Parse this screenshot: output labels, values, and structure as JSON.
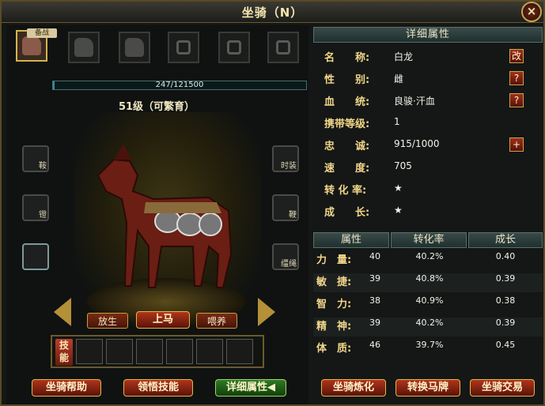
{
  "window": {
    "title": "坐骑（N）",
    "close_label": "×"
  },
  "mount_slots": [
    {
      "tag": "备战",
      "active": true
    },
    {
      "tag": "",
      "active": false
    },
    {
      "tag": "",
      "active": false
    },
    {
      "tag": "",
      "active": false
    },
    {
      "tag": "",
      "active": false
    },
    {
      "tag": "",
      "active": false
    }
  ],
  "exp": {
    "text": "247/121500",
    "current": 247,
    "max": 121500
  },
  "level_text": "51级（可繁育）",
  "equip_left": [
    {
      "label": "鞍"
    },
    {
      "label": "镫"
    },
    {
      "label": ""
    }
  ],
  "equip_right": [
    {
      "label": "时装"
    },
    {
      "label": "鞭"
    },
    {
      "label": "缰绳"
    }
  ],
  "actions": {
    "release": "放生",
    "mount": "上马",
    "feed": "喂养"
  },
  "skills": {
    "tag": "技能",
    "slots": 6
  },
  "bottom_left": {
    "help": "坐骑帮助",
    "learn": "领悟技能",
    "detail": "详细属性◀"
  },
  "detail": {
    "header": "详细属性",
    "name_key": "名　　称:",
    "name_val": "白龙",
    "name_btn": "改",
    "gender_key": "性　　别:",
    "gender_val": "雌",
    "gender_btn": "?",
    "blood_key": "血　　统:",
    "blood_val": "良骏·汗血",
    "blood_btn": "?",
    "carry_key": "携带等级:",
    "carry_val": "1",
    "loyal_key": "忠　　诚:",
    "loyal_val": "915/1000",
    "loyal_btn": "+",
    "speed_key": "速　　度:",
    "speed_val": "705",
    "conv_key": "转 化 率:",
    "conv_val": "★",
    "grow_key": "成　　长:",
    "grow_val": "★"
  },
  "attr_table": {
    "headers": [
      "属性",
      "转化率",
      "成长"
    ],
    "rows": [
      {
        "name": "力　量:",
        "value": "40",
        "rate": "40.2%",
        "growth": "0.40"
      },
      {
        "name": "敏　捷:",
        "value": "39",
        "rate": "40.8%",
        "growth": "0.39"
      },
      {
        "name": "智　力:",
        "value": "38",
        "rate": "40.9%",
        "growth": "0.38"
      },
      {
        "name": "精　神:",
        "value": "39",
        "rate": "40.2%",
        "growth": "0.39"
      },
      {
        "name": "体　质:",
        "value": "46",
        "rate": "39.7%",
        "growth": "0.45"
      }
    ]
  },
  "bottom_right": {
    "refine": "坐骑炼化",
    "convert": "转换马牌",
    "trade": "坐骑交易"
  }
}
